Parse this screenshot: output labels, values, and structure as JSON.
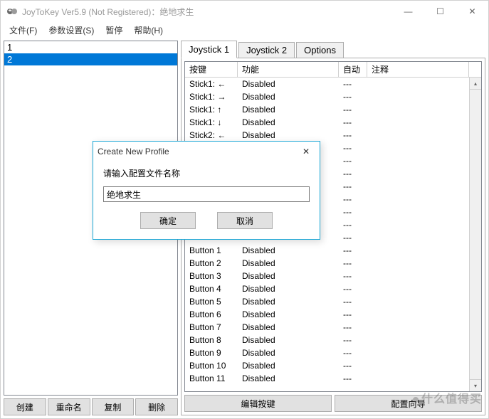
{
  "window": {
    "title": "JoyToKey Ver5.9 (Not Registered)：绝地求生",
    "min_icon": "—",
    "max_icon": "☐",
    "close_icon": "✕"
  },
  "menu": {
    "file": "文件(F)",
    "settings": "参数设置(S)",
    "pause": "暂停",
    "help": "帮助(H)"
  },
  "profiles": {
    "items": [
      "1",
      "2"
    ],
    "selected_index": 1
  },
  "left_buttons": {
    "create": "创建",
    "rename": "重命名",
    "copy": "复制",
    "delete": "删除"
  },
  "tabs": {
    "joystick1": "Joystick 1",
    "joystick2": "Joystick 2",
    "options": "Options"
  },
  "table": {
    "headers": {
      "key": "按键",
      "func": "功能",
      "auto": "自动",
      "note": "注释"
    },
    "rows": [
      {
        "key": "Stick1: ←",
        "func": "Disabled",
        "auto": "---",
        "note": ""
      },
      {
        "key": "Stick1: →",
        "func": "Disabled",
        "auto": "---",
        "note": ""
      },
      {
        "key": "Stick1: ↑",
        "func": "Disabled",
        "auto": "---",
        "note": ""
      },
      {
        "key": "Stick1: ↓",
        "func": "Disabled",
        "auto": "---",
        "note": ""
      },
      {
        "key": "Stick2: ←",
        "func": "Disabled",
        "auto": "---",
        "note": ""
      },
      {
        "key": "",
        "func": "",
        "auto": "---",
        "note": ""
      },
      {
        "key": "",
        "func": "",
        "auto": "---",
        "note": ""
      },
      {
        "key": "",
        "func": "",
        "auto": "---",
        "note": ""
      },
      {
        "key": "",
        "func": "",
        "auto": "---",
        "note": ""
      },
      {
        "key": "",
        "func": "",
        "auto": "---",
        "note": ""
      },
      {
        "key": "",
        "func": "",
        "auto": "---",
        "note": ""
      },
      {
        "key": "",
        "func": "",
        "auto": "---",
        "note": ""
      },
      {
        "key": "",
        "func": "",
        "auto": "---",
        "note": ""
      },
      {
        "key": "Button 1",
        "func": "Disabled",
        "auto": "---",
        "note": ""
      },
      {
        "key": "Button 2",
        "func": "Disabled",
        "auto": "---",
        "note": ""
      },
      {
        "key": "Button 3",
        "func": "Disabled",
        "auto": "---",
        "note": ""
      },
      {
        "key": "Button 4",
        "func": "Disabled",
        "auto": "---",
        "note": ""
      },
      {
        "key": "Button 5",
        "func": "Disabled",
        "auto": "---",
        "note": ""
      },
      {
        "key": "Button 6",
        "func": "Disabled",
        "auto": "---",
        "note": ""
      },
      {
        "key": "Button 7",
        "func": "Disabled",
        "auto": "---",
        "note": ""
      },
      {
        "key": "Button 8",
        "func": "Disabled",
        "auto": "---",
        "note": ""
      },
      {
        "key": "Button 9",
        "func": "Disabled",
        "auto": "---",
        "note": ""
      },
      {
        "key": "Button 10",
        "func": "Disabled",
        "auto": "---",
        "note": ""
      },
      {
        "key": "Button 11",
        "func": "Disabled",
        "auto": "---",
        "note": ""
      }
    ]
  },
  "bottom": {
    "edit": "编辑按键",
    "wizard": "配置向导"
  },
  "dialog": {
    "title": "Create New Profile",
    "label": "请输入配置文件名称",
    "value": "绝地求生",
    "ok": "确定",
    "cancel": "取消",
    "close_icon": "✕"
  },
  "watermark": "什么值得买"
}
